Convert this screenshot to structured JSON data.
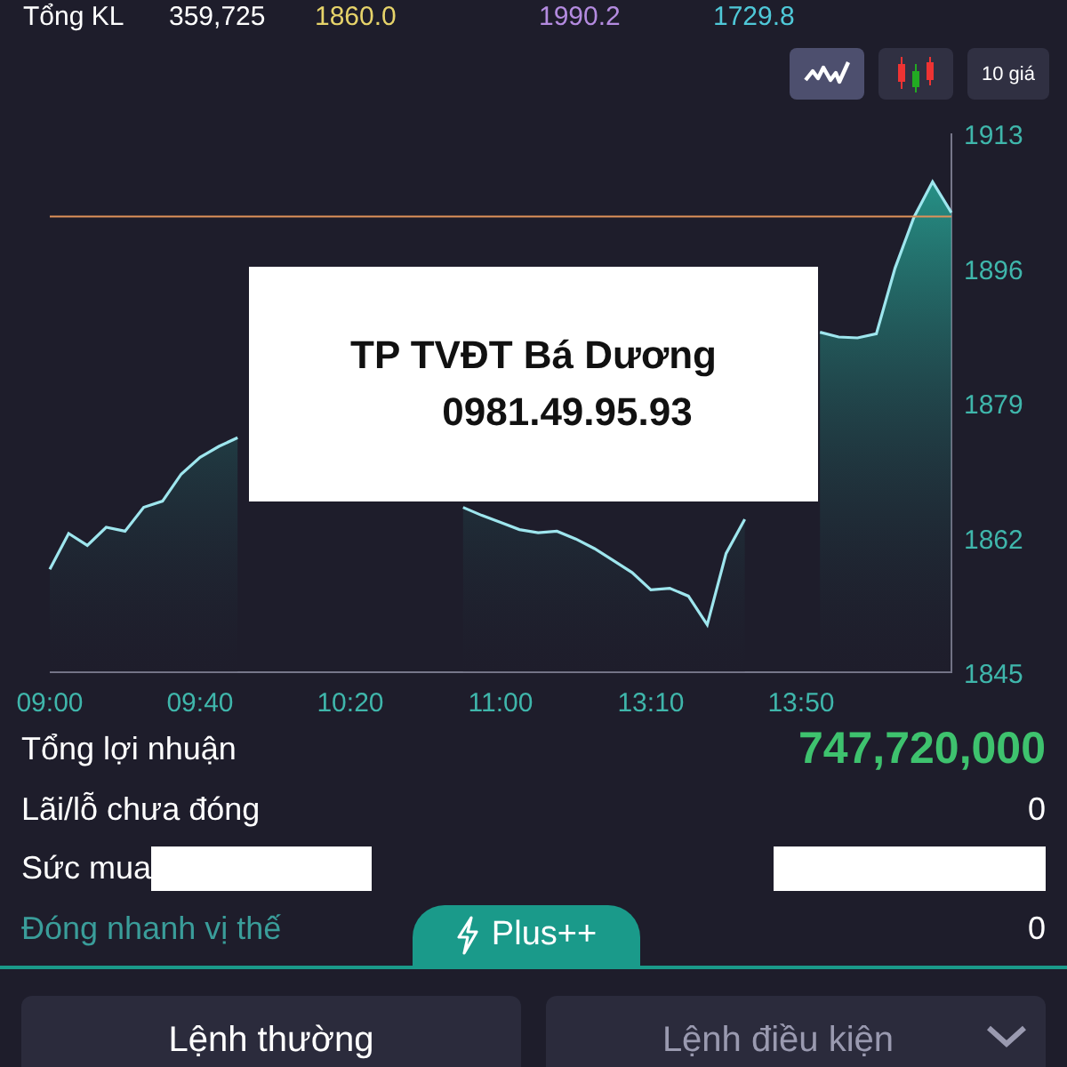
{
  "summary_strip": {
    "label": "Tổng KL",
    "values": [
      {
        "text": "359,725",
        "color": "#ffffff"
      },
      {
        "text": "1860.0",
        "color": "#e6d36a"
      },
      {
        "text": "1990.2",
        "color": "#b48be0"
      },
      {
        "text": "1729.8",
        "color": "#4fc8d8"
      }
    ]
  },
  "chart_toolbar": [
    {
      "kind": "line",
      "selected": true
    },
    {
      "kind": "candle",
      "selected": false
    },
    {
      "kind": "text",
      "label": "10 giá",
      "selected": false
    }
  ],
  "chart": {
    "chart_data": {
      "type": "area",
      "ylim": [
        1845,
        1913
      ],
      "yticks": [
        1845,
        1862,
        1879,
        1896,
        1913
      ],
      "categories": [
        "09:00",
        null,
        null,
        null,
        null,
        null,
        null,
        null,
        "09:40",
        null,
        null,
        null,
        null,
        null,
        null,
        null,
        "10:20",
        null,
        null,
        null,
        null,
        null,
        null,
        null,
        "11:00",
        null,
        null,
        null,
        null,
        null,
        null,
        null,
        "13:10",
        null,
        null,
        null,
        null,
        null,
        null,
        null,
        "13:50",
        null,
        null,
        null,
        null,
        null,
        null,
        null,
        null
      ],
      "series": [
        {
          "color": "#9ee6ee",
          "values": [
            1858,
            1862.5,
            1861,
            1863.3,
            1862.8,
            1865.8,
            1866.6,
            1870,
            1872.1,
            1873.5,
            1874.6,
            null,
            null,
            null,
            null,
            null,
            null,
            null,
            null,
            null,
            null,
            null,
            1865.8,
            1864.8,
            1863.9,
            1863,
            1862.6,
            1862.8,
            1861.8,
            1860.6,
            1859.1,
            1857.6,
            1855.4,
            1855.6,
            1854.6,
            1851,
            1860,
            1864.3,
            null,
            null,
            null,
            1887.9,
            1887.3,
            1887.2,
            1887.7,
            1896,
            1902.4,
            1906.9,
            1903
          ]
        },
        {
          "type": "line",
          "color": "#e0925a",
          "values": [
            1902.5,
            1902.5,
            1902.5,
            1902.5,
            1902.5,
            1902.5,
            1902.5,
            1902.5,
            1902.5,
            1902.5,
            1902.5,
            1902.5,
            1902.5,
            1902.5,
            1902.5,
            1902.5,
            1902.5,
            1902.5,
            1902.5,
            1902.5,
            1902.5,
            1902.5,
            1902.5,
            1902.5,
            1902.5,
            1902.5,
            1902.5,
            1902.5,
            1902.5,
            1902.5,
            1902.5,
            1902.5,
            1902.5,
            1902.5,
            1902.5,
            1902.5,
            1902.5,
            1902.5,
            1902.5,
            1902.5,
            1902.5,
            1902.5,
            1902.5,
            1902.5,
            1902.5,
            1902.5,
            1902.5,
            1902.5,
            1902.5
          ]
        }
      ]
    }
  },
  "overlay_note": {
    "lines": [
      "TP TVĐT Bá Dương",
      "0981.49.95.93"
    ]
  },
  "summary": [
    {
      "label": "Tổng lợi nhuận",
      "value": "747,720,000",
      "kind": "profit"
    },
    {
      "label": "Lãi/lỗ chưa đóng",
      "value": "0",
      "kind": "plain"
    },
    {
      "label": "Sức mua",
      "kind": "redacted"
    },
    {
      "label": "Đóng nhanh vị thế",
      "value": "0",
      "kind": "link"
    }
  ],
  "plus_tab": {
    "label": "Plus++"
  },
  "order_tabs": [
    {
      "label": "Lệnh thường",
      "selected": true,
      "dropdown": false
    },
    {
      "label": "Lệnh điều kiện",
      "selected": false,
      "dropdown": true
    }
  ]
}
